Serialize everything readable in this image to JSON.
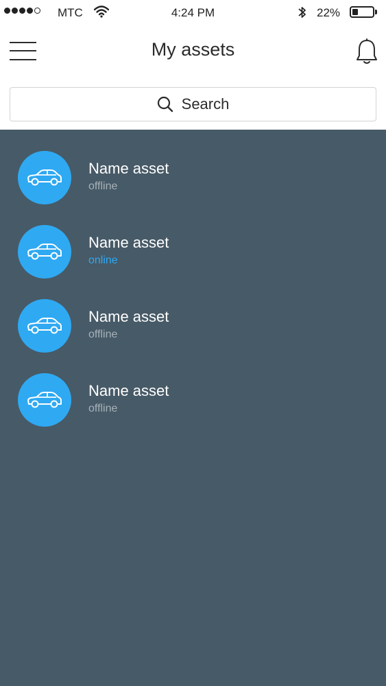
{
  "status_bar": {
    "carrier": "МТС",
    "time": "4:24 PM",
    "battery": "22%"
  },
  "header": {
    "title": "My assets",
    "menu_icon": "hamburger-menu-icon",
    "bell_icon": "bell-icon"
  },
  "search": {
    "label": "Search",
    "icon": "search-icon"
  },
  "assets": [
    {
      "name": "Name asset",
      "status": "offline",
      "icon": "car-icon"
    },
    {
      "name": "Name asset",
      "status": "online",
      "icon": "car-icon"
    },
    {
      "name": "Name asset",
      "status": "offline",
      "icon": "car-icon"
    },
    {
      "name": "Name asset",
      "status": "offline",
      "icon": "car-icon"
    }
  ],
  "colors": {
    "accent": "#2fa9f2",
    "list_background": "#475a67",
    "offline_text": "#a7b2ba"
  }
}
